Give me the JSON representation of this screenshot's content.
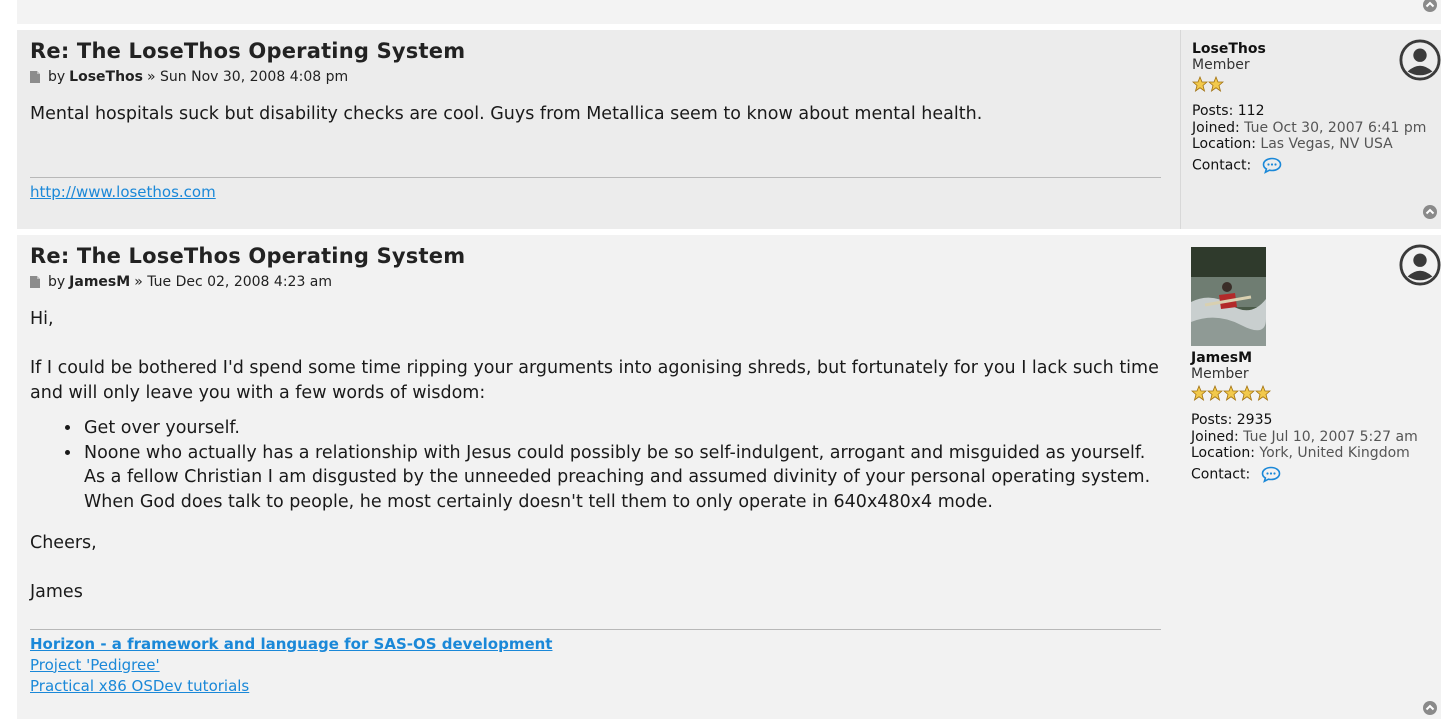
{
  "posts": [
    {
      "title": "Re: The LoseThos Operating System",
      "by": "by",
      "author": "LoseThos",
      "sep": "»",
      "date": "Sun Nov 30, 2008 4:08 pm",
      "content": "Mental hospitals suck but disability checks are cool. Guys from Metallica seem to know about mental health.",
      "signature": [
        "http://www.losethos.com"
      ],
      "profile": {
        "username": "LoseThos",
        "rank": "Member",
        "stars": 2,
        "posts_label": "Posts:",
        "posts": "112",
        "joined_label": "Joined:",
        "joined": "Tue Oct 30, 2007 6:41 pm",
        "location_label": "Location:",
        "location": "Las Vegas, NV USA",
        "contact_label": "Contact:"
      }
    },
    {
      "title": "Re: The LoseThos Operating System",
      "by": "by",
      "author": "JamesM",
      "sep": "»",
      "date": "Tue Dec 02, 2008 4:23 am",
      "greeting": "Hi,",
      "intro": "If I could be bothered I'd spend some time ripping your arguments into agonising shreds, but fortunately for you I lack such time and will only leave you with a few words of wisdom:",
      "bullets": [
        "Get over yourself.",
        "Noone who actually has a relationship with Jesus could possibly be so self-indulgent, arrogant and misguided as yourself. As a fellow Christian I am disgusted by the unneeded preaching and assumed divinity of your personal operating system. When God does talk to people, he most certainly doesn't tell them to only operate in 640x480x4 mode."
      ],
      "closing": "Cheers,",
      "name": "James",
      "signature": [
        "Horizon - a framework and language for SAS-OS development",
        "Project 'Pedigree'",
        "Practical x86 OSDev tutorials"
      ],
      "profile": {
        "username": "JamesM",
        "rank": "Member",
        "stars": 5,
        "posts_label": "Posts:",
        "posts": "2935",
        "joined_label": "Joined:",
        "joined": "Tue Jul 10, 2007 5:27 am",
        "location_label": "Location:",
        "location": "York, United Kingdom",
        "contact_label": "Contact:"
      }
    }
  ],
  "colors": {
    "link": "#1a88d8",
    "post_bg_1": "#ececec",
    "post_bg_2": "#f2f2f2",
    "star": "#e0a81c"
  },
  "icons": [
    "document-icon",
    "default-avatar-icon",
    "back-to-top-icon",
    "contact-chat-icon",
    "rank-star-icon"
  ]
}
